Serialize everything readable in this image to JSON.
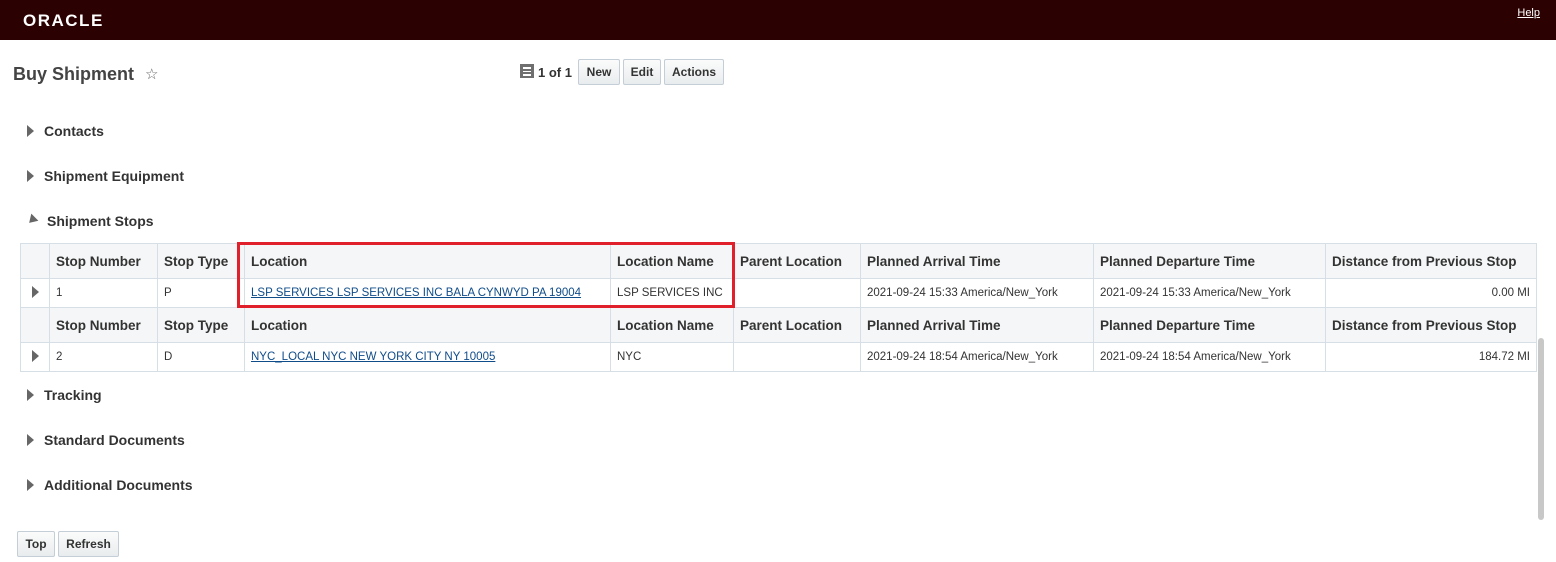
{
  "header": {
    "logo": "ORACLE",
    "help": "Help"
  },
  "page": {
    "title": "Buy Shipment",
    "star": "☆"
  },
  "toolbar": {
    "pager": "1 of 1",
    "new_label": "New",
    "edit_label": "Edit",
    "actions_label": "Actions"
  },
  "sections": {
    "contacts": "Contacts",
    "equipment": "Shipment Equipment",
    "stops": "Shipment Stops",
    "tracking": "Tracking",
    "standard_docs": "Standard Documents",
    "additional_docs": "Additional Documents"
  },
  "table": {
    "columns": [
      "Stop Number",
      "Stop Type",
      "Location",
      "Location Name",
      "Parent Location",
      "Planned Arrival Time",
      "Planned Departure Time",
      "Distance from Previous Stop"
    ],
    "rows": [
      {
        "stop_number": "1",
        "stop_type": "P",
        "location": "LSP SERVICES LSP SERVICES INC BALA CYNWYD PA 19004",
        "location_name": "LSP SERVICES INC",
        "parent_location": "",
        "arrival": "2021-09-24 15:33 America/New_York",
        "departure": "2021-09-24 15:33 America/New_York",
        "distance": "0.00 MI"
      },
      {
        "stop_number": "2",
        "stop_type": "D",
        "location": "NYC_LOCAL NYC NEW YORK CITY NY 10005",
        "location_name": "NYC",
        "parent_location": "",
        "arrival": "2021-09-24 18:54 America/New_York",
        "departure": "2021-09-24 18:54 America/New_York",
        "distance": "184.72 MI"
      }
    ]
  },
  "footer": {
    "top_label": "Top",
    "refresh_label": "Refresh"
  },
  "colors": {
    "header_bg": "#2b0101",
    "link": "#0f4c8a",
    "highlight": "#e0202a"
  }
}
